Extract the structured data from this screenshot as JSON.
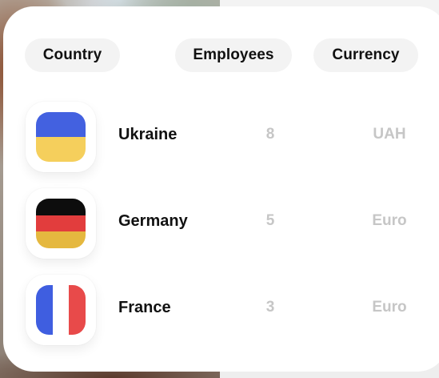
{
  "header": {
    "country_label": "Country",
    "employees_label": "Employees",
    "currency_label": "Currency"
  },
  "rows": [
    {
      "country": "Ukraine",
      "employees": "8",
      "currency": "UAH",
      "flag": {
        "orientation": "horizontal",
        "colors": [
          "#4361e0",
          "#f5cf5c"
        ]
      }
    },
    {
      "country": "Germany",
      "employees": "5",
      "currency": "Euro",
      "flag": {
        "orientation": "horizontal",
        "colors": [
          "#0d0d0d",
          "#e23d3d",
          "#e5b83f"
        ]
      }
    },
    {
      "country": "France",
      "employees": "3",
      "currency": "Euro",
      "flag": {
        "orientation": "vertical",
        "colors": [
          "#3f5ee0",
          "#ffffff",
          "#e84a4a"
        ]
      }
    }
  ]
}
